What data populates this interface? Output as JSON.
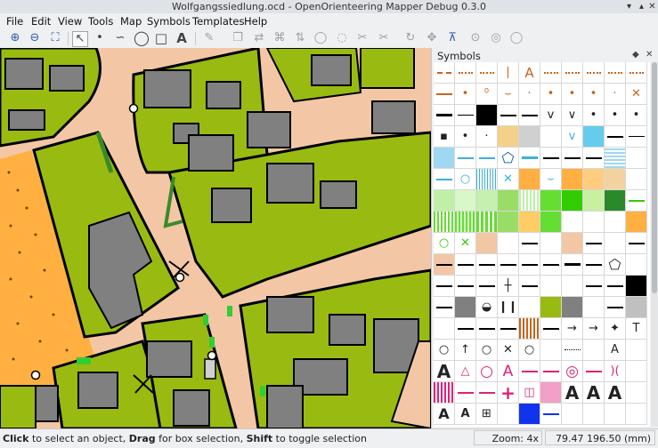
{
  "window": {
    "title": "Wolfgangssiedlung.ocd - OpenOrienteering Mapper Debug 0.3.0"
  },
  "menu": [
    "File",
    "Edit",
    "View",
    "Tools",
    "Map",
    "Symbols",
    "Templates",
    "Help"
  ],
  "toolbar": {
    "icons": [
      "zoom-in-icon",
      "zoom-out-icon",
      "fit-view-icon",
      "edit-tool-icon",
      "point-tool-icon",
      "path-tool-icon",
      "circle-tool-icon",
      "rectangle-tool-icon",
      "text-tool-icon",
      "pen-icon",
      "duplicate-icon",
      "switch-symbol-icon",
      "fill-border-icon",
      "switch-direction-icon",
      "connect-paths-icon",
      "cut-tool-icon",
      "cut-hole-icon",
      "rotate-icon",
      "measure-icon",
      "boolean-union-icon",
      "boolean-intersect-icon",
      "boolean-difference-icon"
    ]
  },
  "symbols_panel": {
    "title": "Symbols"
  },
  "status": {
    "click": "Click",
    "click_text": " to select an object, ",
    "drag": "Drag",
    "drag_text": " for box selection, ",
    "shift": "Shift",
    "shift_text": " to toggle selection",
    "zoom": "Zoom: 4x",
    "coords": "79.47 196.50 (mm)"
  },
  "colors": {
    "paved": "#f3c7a5",
    "olive": "#99bb11",
    "building": "#808080",
    "black": "#000000",
    "orange": "#ffb040",
    "green": "#3a8a2a",
    "cyan": "#66ccee",
    "magenta": "#dd2277",
    "brown": "#c8641e"
  }
}
